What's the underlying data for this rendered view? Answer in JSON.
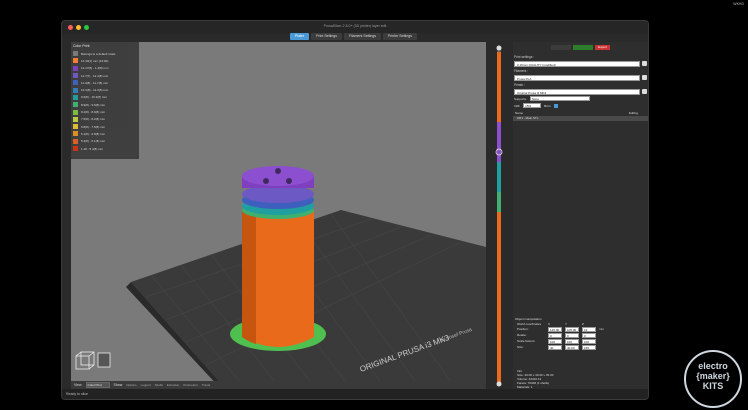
{
  "system": {
    "topbar_text": "WKHD"
  },
  "window": {
    "title": "PrusaSlicer-2.5.0+ (3D printer) layer edit",
    "tabs": [
      {
        "label": "Plater",
        "active": true
      },
      {
        "label": "Print Settings",
        "active": false
      },
      {
        "label": "Filament Settings",
        "active": false
      },
      {
        "label": "Printer Settings",
        "active": false
      }
    ]
  },
  "legend": {
    "title": "Color Print",
    "items": [
      {
        "color": "#7a7a7a",
        "label": "Belongs to a default scale"
      },
      {
        "color": "#ff7f27",
        "label": "14.30(1) mm (13:00)"
      },
      {
        "color": "#7f3fbf",
        "label": "12.17(8) - 1.4(8) mm"
      },
      {
        "color": "#6c59c4",
        "label": "11.7(7) - 12.4(8) mm"
      },
      {
        "color": "#3f5fbf",
        "label": "11.0(8) - 11.7(8) mm"
      },
      {
        "color": "#2f7fbf",
        "label": "10.3(8) - 11.0(8) mm"
      },
      {
        "color": "#1f9f9f",
        "label": "9.6(8) - 10.3(8) mm"
      },
      {
        "color": "#3fb06f",
        "label": "8.9(8) - 9.6(8) mm"
      },
      {
        "color": "#7fc03f",
        "label": "8.2(8) - 8.9(8) mm"
      },
      {
        "color": "#bfcf3f",
        "label": "7.5(8) - 8.2(8) mm"
      },
      {
        "color": "#e0c030",
        "label": "6.8(8) - 7.5(8) mm"
      },
      {
        "color": "#e09020",
        "label": "6.1(8) - 6.8(8) mm"
      },
      {
        "color": "#e06020",
        "label": "5.4(8) - 6.1(8) mm"
      },
      {
        "color": "#d03010",
        "label": "1.18 - 5.4(8) mm"
      }
    ]
  },
  "bed": {
    "brand": "ORIGINAL PRUSA i3 MK3",
    "sub": "by Josef Prusa"
  },
  "view_bar": {
    "view_label": "View",
    "view_select": "Color Print",
    "show_label": "Show",
    "tool_items": [
      "Options",
      "Legend",
      "Shells",
      "Extrusion",
      "Perimeters",
      "Travel"
    ]
  },
  "sidebar": {
    "expert_label": "Expert",
    "print_settings_label": "Print settings :",
    "print_settings_value": "0.15mm QUALITY (modified)",
    "filament_label": "Filament :",
    "filament_value": "Prusa PLA",
    "printer_label": "Printer :",
    "printer_value": "Original Prusa i3 MK3",
    "supports_label": "Supports:",
    "supports_value": "None",
    "infill_label": "Infill:",
    "infill_value": "15%",
    "brim_label": "Brim:",
    "list_header_name": "Name",
    "list_header_editing": "Editing",
    "object_name": "HR1 - Main.STL",
    "object_manipulation": "Object manipulation",
    "world_coordinates": "World coordinates",
    "axes": [
      "X",
      "Y",
      "Z"
    ],
    "position_label": "Position:",
    "position": [
      "125.00",
      "105.00",
      "19"
    ],
    "rotation_label": "Rotate:",
    "rotation": [
      "0",
      "0",
      "0"
    ],
    "scale_label": "Scale factors:",
    "scale": [
      "100",
      "100",
      "100"
    ],
    "size_label": "Size:",
    "size": [
      "40",
      "40.00",
      "155"
    ],
    "units_mm": "mm",
    "info_title": "Info",
    "info_size": "Size:   40.00 x 40.00 x 45.00",
    "info_volume": "Volume:  42310.13",
    "info_facets": "Facets:   76348 (1 shells)",
    "info_materials": "Materials: 1",
    "info_manifold": "Manifold: Yes",
    "slice_button": "Slice now"
  },
  "slider": {
    "top_value": "45.30",
    "mid_value": "12.4(8)",
    "bottom_value": "0.20"
  },
  "statusbar": {
    "text": "Ready to slice"
  },
  "watermark": {
    "lines": [
      "electro",
      "{maker}",
      "KITS"
    ]
  }
}
